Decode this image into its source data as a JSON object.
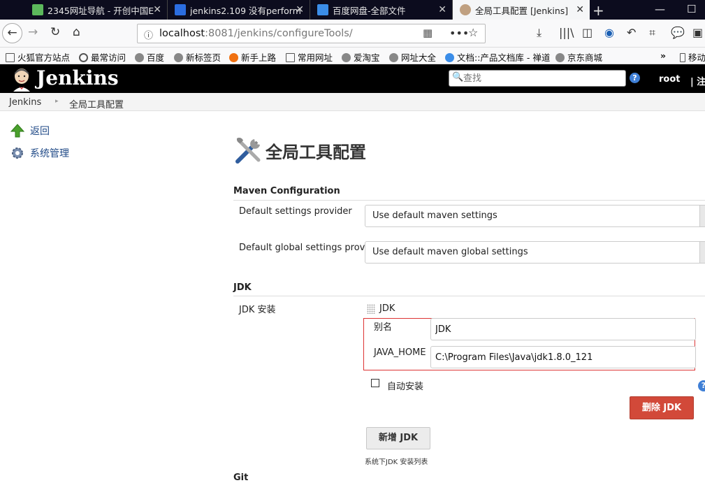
{
  "browser": {
    "tabs": [
      {
        "label": "2345网址导航 - 开创中国E",
        "icon": "home-icon",
        "color": "#5cb85c"
      },
      {
        "label": "jenkins2.109 没有perform",
        "icon": "baidu-paw-icon",
        "color": "#2b6de0"
      },
      {
        "label": "百度网盘-全部文件",
        "icon": "baidu-cloud-icon",
        "color": "#3b8de8"
      },
      {
        "label": "全局工具配置 [Jenkins]",
        "icon": "jenkins-butler-icon",
        "color": "#c0a080"
      }
    ],
    "url_host": "localhost",
    "url_rest": ":8081/jenkins/configureTools/",
    "bookmarks": [
      {
        "label": "火狐官方站点",
        "icon": "folder-icon"
      },
      {
        "label": "最常访问",
        "icon": "gear-icon"
      },
      {
        "label": "百度",
        "icon": "globe-icon"
      },
      {
        "label": "新标签页",
        "icon": "globe-icon"
      },
      {
        "label": "新手上路",
        "icon": "firefox-icon"
      },
      {
        "label": "常用网址",
        "icon": "folder-icon"
      },
      {
        "label": "爱淘宝",
        "icon": "globe-icon"
      },
      {
        "label": "网址大全",
        "icon": "globe-icon"
      },
      {
        "label": "文档::产品文档库 - 禅道",
        "icon": "chrome-icon"
      },
      {
        "label": "京东商城",
        "icon": "globe-icon"
      },
      {
        "label": "移动",
        "icon": "mobile-icon"
      }
    ]
  },
  "jenkins": {
    "brand": "Jenkins",
    "search_placeholder": "查找",
    "user": "root",
    "logout": "| 注"
  },
  "breadcrumb": {
    "home": "Jenkins",
    "current": "全局工具配置"
  },
  "sidebar": {
    "items": [
      {
        "label": "返回",
        "icon": "up-arrow-icon"
      },
      {
        "label": "系统管理",
        "icon": "gear-icon"
      }
    ]
  },
  "page": {
    "title": "全局工具配置",
    "maven": {
      "heading": "Maven Configuration",
      "settings_label": "Default settings provider",
      "settings_value": "Use default maven settings",
      "global_label": "Default global settings provider",
      "global_value": "Use default maven global settings"
    },
    "jdk": {
      "heading": "JDK",
      "install_label": "JDK 安装",
      "item_title": "JDK",
      "alias_label": "别名",
      "alias_value": "JDK",
      "home_label": "JAVA_HOME",
      "home_value": "C:\\Program Files\\Java\\jdk1.8.0_121",
      "auto_install_label": "自动安装",
      "auto_install_checked": false,
      "delete_button": "删除 JDK",
      "add_button": "新增 JDK",
      "hint": "系统下JDK 安装列表"
    },
    "next_section": "Git"
  }
}
